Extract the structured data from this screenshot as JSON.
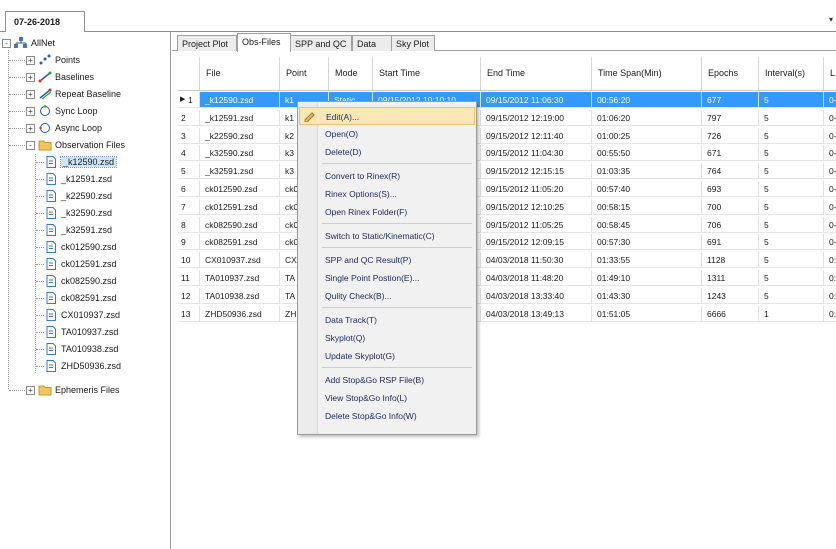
{
  "date_tab": {
    "label": "07-26-2018"
  },
  "tree": {
    "root": "AllNet",
    "nodes": [
      {
        "label": "Points",
        "icon": "points-icon"
      },
      {
        "label": "Baselines",
        "icon": "baselines-icon"
      },
      {
        "label": "Repeat Baseline",
        "icon": "repeat-baseline-icon"
      },
      {
        "label": "Sync Loop",
        "icon": "sync-loop-icon"
      },
      {
        "label": "Async Loop",
        "icon": "async-loop-icon"
      },
      {
        "label": "Observation Files",
        "icon": "folder-icon"
      }
    ],
    "files": [
      "_k12590.zsd",
      "_k12591.zsd",
      "_k22590.zsd",
      "_k32590.zsd",
      "_k32591.zsd",
      "ck012590.zsd",
      "ck012591.zsd",
      "ck082590.zsd",
      "ck082591.zsd",
      "CX010937.zsd",
      "TA010937.zsd",
      "TA010938.zsd",
      "ZHD50936.zsd"
    ],
    "ephemeris": "Ephemeris Files"
  },
  "tabs": [
    "Project Plot",
    "Obs-Files",
    "SPP and QC",
    "Data",
    "Sky Plot"
  ],
  "active_tab": "Obs-Files",
  "columns": [
    "File",
    "Point",
    "Mode",
    "Start Time",
    "End Time",
    "Time Span(Min)",
    "Epochs",
    "Interval(s)",
    "L"
  ],
  "rows": [
    {
      "n": "1",
      "file": "_k12590.zsd",
      "point": "k1",
      "mode": "Static",
      "start": "09/15/2012 10:10:10",
      "end": "09/15/2012 11:06:30",
      "span": "00:56:20",
      "epochs": "677",
      "interval": "5",
      "l": "0-"
    },
    {
      "n": "2",
      "file": "_k12591.zsd",
      "point": "k1",
      "mode": "",
      "start": "",
      "end": "09/15/2012 12:19:00",
      "span": "01:06:20",
      "epochs": "797",
      "interval": "5",
      "l": "0-"
    },
    {
      "n": "3",
      "file": "_k22590.zsd",
      "point": "k2",
      "mode": "",
      "start": "",
      "end": "09/15/2012 12:11:40",
      "span": "01:00:25",
      "epochs": "726",
      "interval": "5",
      "l": "0-"
    },
    {
      "n": "4",
      "file": "_k32590.zsd",
      "point": "k3",
      "mode": "",
      "start": "",
      "end": "09/15/2012 11:04:30",
      "span": "00:55:50",
      "epochs": "671",
      "interval": "5",
      "l": "0-"
    },
    {
      "n": "5",
      "file": "_k32591.zsd",
      "point": "k3",
      "mode": "",
      "start": "",
      "end": "09/15/2012 12:15:15",
      "span": "01:03:35",
      "epochs": "764",
      "interval": "5",
      "l": "0-"
    },
    {
      "n": "6",
      "file": "ck012590.zsd",
      "point": "ck0",
      "mode": "",
      "start": "",
      "end": "09/15/2012 11:05:20",
      "span": "00:57:40",
      "epochs": "693",
      "interval": "5",
      "l": "0-"
    },
    {
      "n": "7",
      "file": "ck012591.zsd",
      "point": "ck0",
      "mode": "",
      "start": "",
      "end": "09/15/2012 12:10:25",
      "span": "00:58:15",
      "epochs": "700",
      "interval": "5",
      "l": "0-"
    },
    {
      "n": "8",
      "file": "ck082590.zsd",
      "point": "ck0",
      "mode": "",
      "start": "",
      "end": "09/15/2012 11:05:25",
      "span": "00:58:45",
      "epochs": "706",
      "interval": "5",
      "l": "0-"
    },
    {
      "n": "9",
      "file": "ck082591.zsd",
      "point": "ck0",
      "mode": "",
      "start": "",
      "end": "09/15/2012 12:09:15",
      "span": "00:57:30",
      "epochs": "691",
      "interval": "5",
      "l": "0-"
    },
    {
      "n": "10",
      "file": "CX010937.zsd",
      "point": "CX",
      "mode": "",
      "start": "",
      "end": "04/03/2018 11:50:30",
      "span": "01:33:55",
      "epochs": "1128",
      "interval": "5",
      "l": "0:"
    },
    {
      "n": "11",
      "file": "TA010937.zsd",
      "point": "TA",
      "mode": "",
      "start": "",
      "end": "04/03/2018 11:48:20",
      "span": "01:49:10",
      "epochs": "1311",
      "interval": "5",
      "l": "0:"
    },
    {
      "n": "12",
      "file": "TA010938.zsd",
      "point": "TA",
      "mode": "",
      "start": "",
      "end": "04/03/2018 13:33:40",
      "span": "01:43:30",
      "epochs": "1243",
      "interval": "5",
      "l": "0:"
    },
    {
      "n": "13",
      "file": "ZHD50936.zsd",
      "point": "ZH",
      "mode": "",
      "start": "",
      "end": "04/03/2018 13:49:13",
      "span": "01:51:05",
      "epochs": "6666",
      "interval": "1",
      "l": "0:"
    }
  ],
  "context_menu": {
    "groups": [
      [
        "Edit(A)...",
        "Open(O)",
        "Delete(D)"
      ],
      [
        "Convert to Rinex(R)",
        "Rinex Options(S)...",
        "Open Rinex Folder(F)"
      ],
      [
        "Switch to Static/Kinematic(C)"
      ],
      [
        "SPP and QC Result(P)",
        "Single Point Postion(E)...",
        "Qulity Check(B)..."
      ],
      [
        "Data Track(T)",
        "Skyplot(Q)",
        "Update Skyplot(G)"
      ],
      [
        "Add Stop&Go RSP File(B)",
        "View Stop&Go Info(L)",
        "Delete Stop&Go Info(W)"
      ]
    ]
  },
  "colors": {
    "selection": "#3399ff",
    "menu_hover": "#f9e8b5",
    "folder": "#f2c55c",
    "file": "#3a78c8"
  }
}
